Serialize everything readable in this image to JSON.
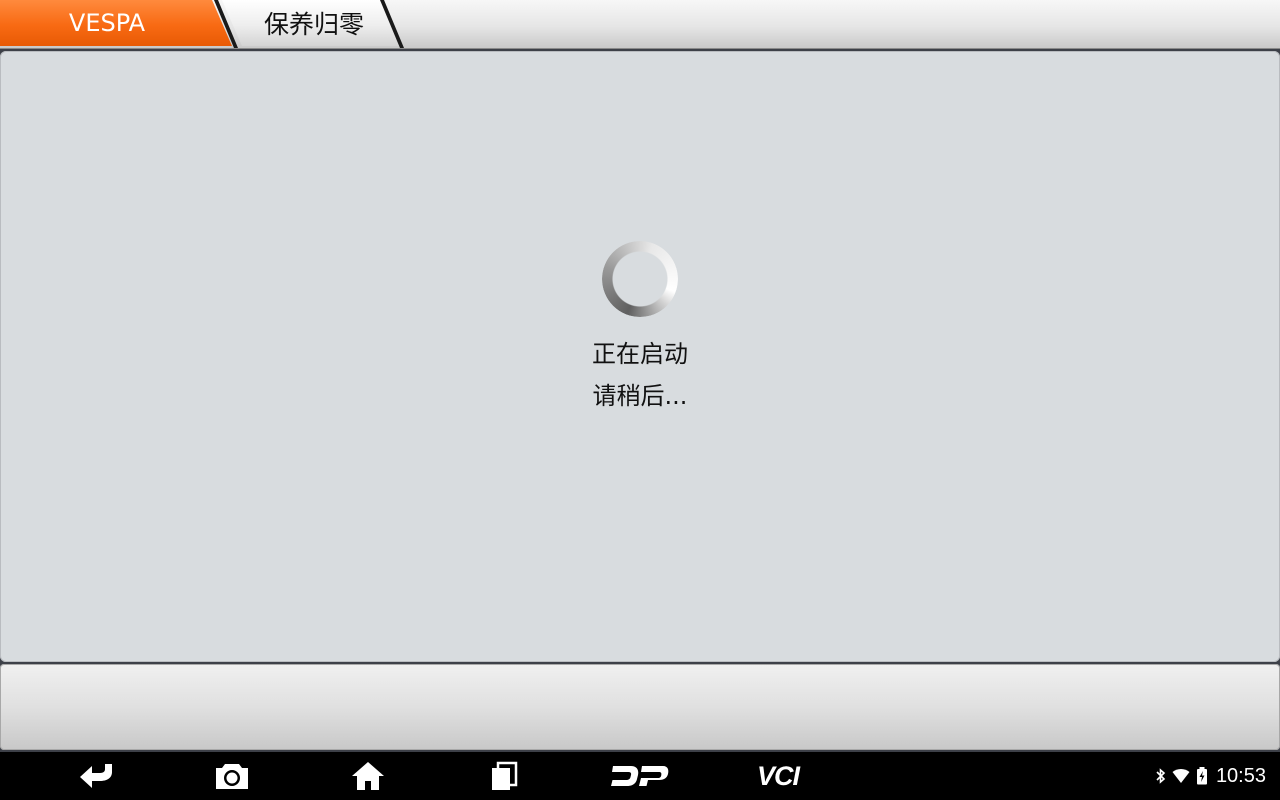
{
  "breadcrumb": {
    "items": [
      {
        "label": "VESPA"
      },
      {
        "label": "保养归零"
      }
    ]
  },
  "loading": {
    "line1": "正在启动",
    "line2": "请稍后..."
  },
  "navbar": {
    "buttons": [
      "back-icon",
      "camera-icon",
      "home-icon",
      "recent-apps-icon",
      "dp-icon",
      "vci-icon"
    ],
    "vci_label": "VCI"
  },
  "status": {
    "icons": [
      "bluetooth-icon",
      "wifi-icon",
      "battery-charging-icon"
    ],
    "time": "10:53"
  },
  "colors": {
    "accent": "#f86a13",
    "panel": "#d8dcdf",
    "navbar": "#000000"
  }
}
